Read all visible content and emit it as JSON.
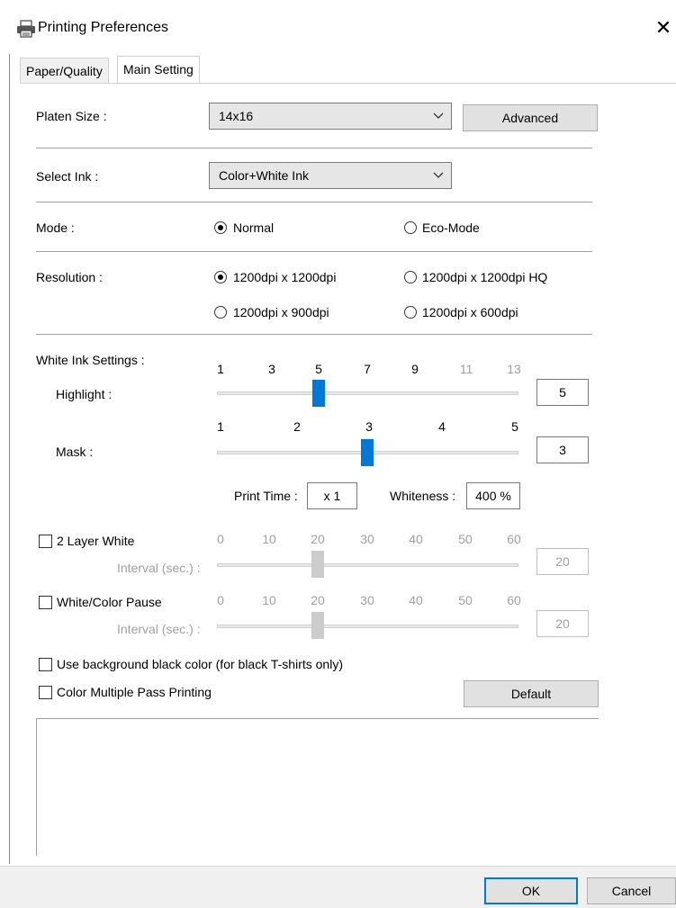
{
  "window": {
    "title": "Printing Preferences",
    "close_glyph": "✕"
  },
  "tabs": [
    {
      "label": "Paper/Quality",
      "active": false
    },
    {
      "label": "Main Setting",
      "active": true
    }
  ],
  "platen": {
    "label": "Platen Size :",
    "value": "14x16",
    "advanced_label": "Advanced"
  },
  "ink": {
    "label": "Select Ink :",
    "value": "Color+White Ink"
  },
  "mode": {
    "label": "Mode :",
    "options": [
      "Normal",
      "Eco-Mode"
    ],
    "selected": "Normal"
  },
  "resolution": {
    "label": "Resolution :",
    "options": [
      "1200dpi x 1200dpi",
      "1200dpi x 1200dpi HQ",
      "1200dpi x 900dpi",
      "1200dpi x 600dpi"
    ],
    "selected": "1200dpi x 1200dpi"
  },
  "white_ink": {
    "label": "White Ink Settings :",
    "highlight": {
      "label": "Highlight :",
      "ticks": [
        "1",
        "3",
        "5",
        "7",
        "9",
        "11",
        "13"
      ],
      "value": "5"
    },
    "mask": {
      "label": "Mask :",
      "ticks": [
        "1",
        "2",
        "3",
        "4",
        "5"
      ],
      "value": "3"
    },
    "print_time": {
      "label": "Print Time :",
      "value": "x 1"
    },
    "whiteness": {
      "label": "Whiteness :",
      "value": "400 %"
    }
  },
  "layer_white": {
    "label": "2 Layer White",
    "checked": false,
    "interval_label": "Interval (sec.) :",
    "ticks": [
      "0",
      "10",
      "20",
      "30",
      "40",
      "50",
      "60"
    ],
    "value": "20"
  },
  "white_color_pause": {
    "label": "White/Color Pause",
    "checked": false,
    "interval_label": "Interval (sec.) :",
    "ticks": [
      "0",
      "10",
      "20",
      "30",
      "40",
      "50",
      "60"
    ],
    "value": "20"
  },
  "options": {
    "bg_black_label": "Use background black color (for black T-shirts only)",
    "multi_pass_label": "Color Multiple Pass Printing",
    "default_label": "Default"
  },
  "footer": {
    "ok_label": "OK",
    "cancel_label": "Cancel"
  },
  "colors": {
    "accent": "#0078d7",
    "disabled": "#a0a0a0"
  }
}
